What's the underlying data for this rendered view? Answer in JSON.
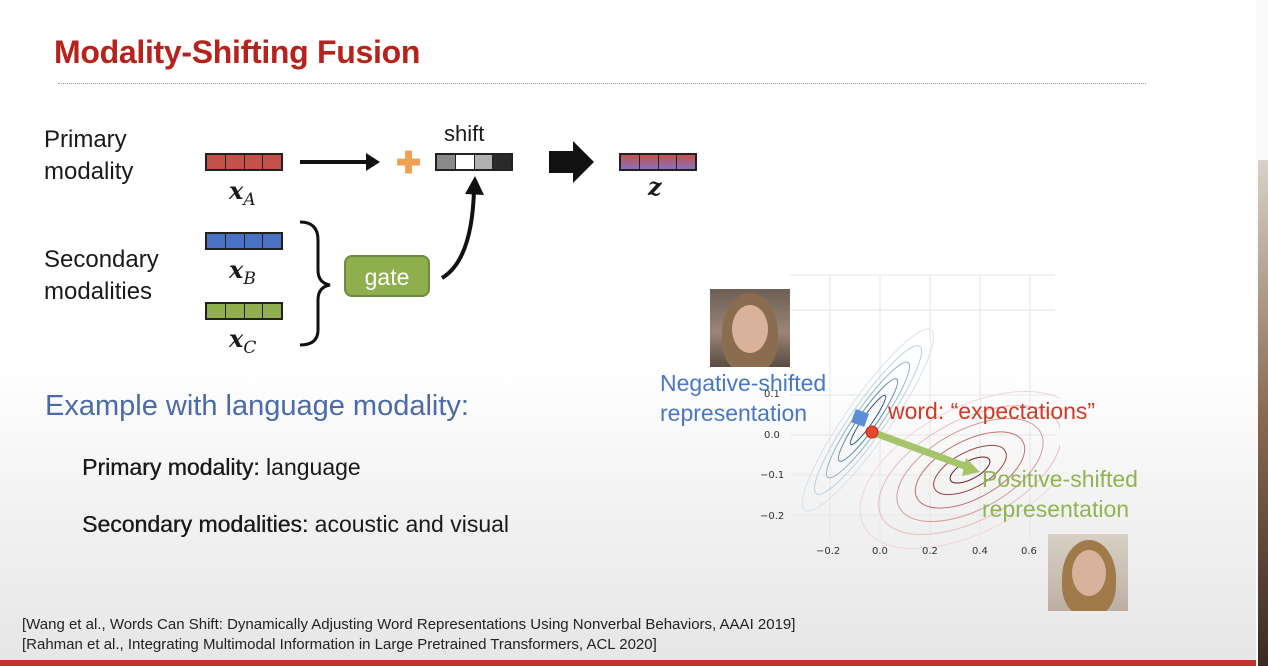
{
  "slide": {
    "title": "Modality-Shifting Fusion"
  },
  "diagram": {
    "primary_label": [
      "Primary",
      "modality"
    ],
    "secondary_label": [
      "Secondary",
      "modalities"
    ],
    "shift_label": "shift",
    "gate_label": "gate",
    "var_a": "x",
    "var_a_sub": "A",
    "var_b": "x",
    "var_b_sub": "B",
    "var_c": "x",
    "var_c_sub": "C",
    "var_z": "z",
    "plus_symbol": "✚",
    "colors": {
      "primary": "#c4524a",
      "secondary_b": "#4a72c4",
      "secondary_c": "#8fae4e",
      "gate": "#8fae4e",
      "plus": "#f0a050"
    }
  },
  "example": {
    "heading": "Example with language modality:",
    "primary_key": "Primary modality:",
    "primary_value": " language",
    "secondary_key": "Secondary modalities:",
    "secondary_value": " acoustic and visual"
  },
  "plot": {
    "neg_label": [
      "Negative-shifted",
      "representation"
    ],
    "word_label": "word: “expectations”",
    "pos_label": [
      "Positive-shifted",
      "representation"
    ],
    "x_ticks": [
      "−0.2",
      "0.0",
      "0.2",
      "0.4",
      "0.6"
    ],
    "y_ticks": [
      "0.1",
      "0.0",
      "−0.1",
      "−0.2"
    ]
  },
  "references": [
    "[Wang et al., Words Can Shift: Dynamically Adjusting Word Representations Using Nonverbal Behaviors, AAAI 2019]",
    "[Rahman et al., Integrating Multimodal Information in Large Pretrained Transformers, ACL 2020]"
  ]
}
